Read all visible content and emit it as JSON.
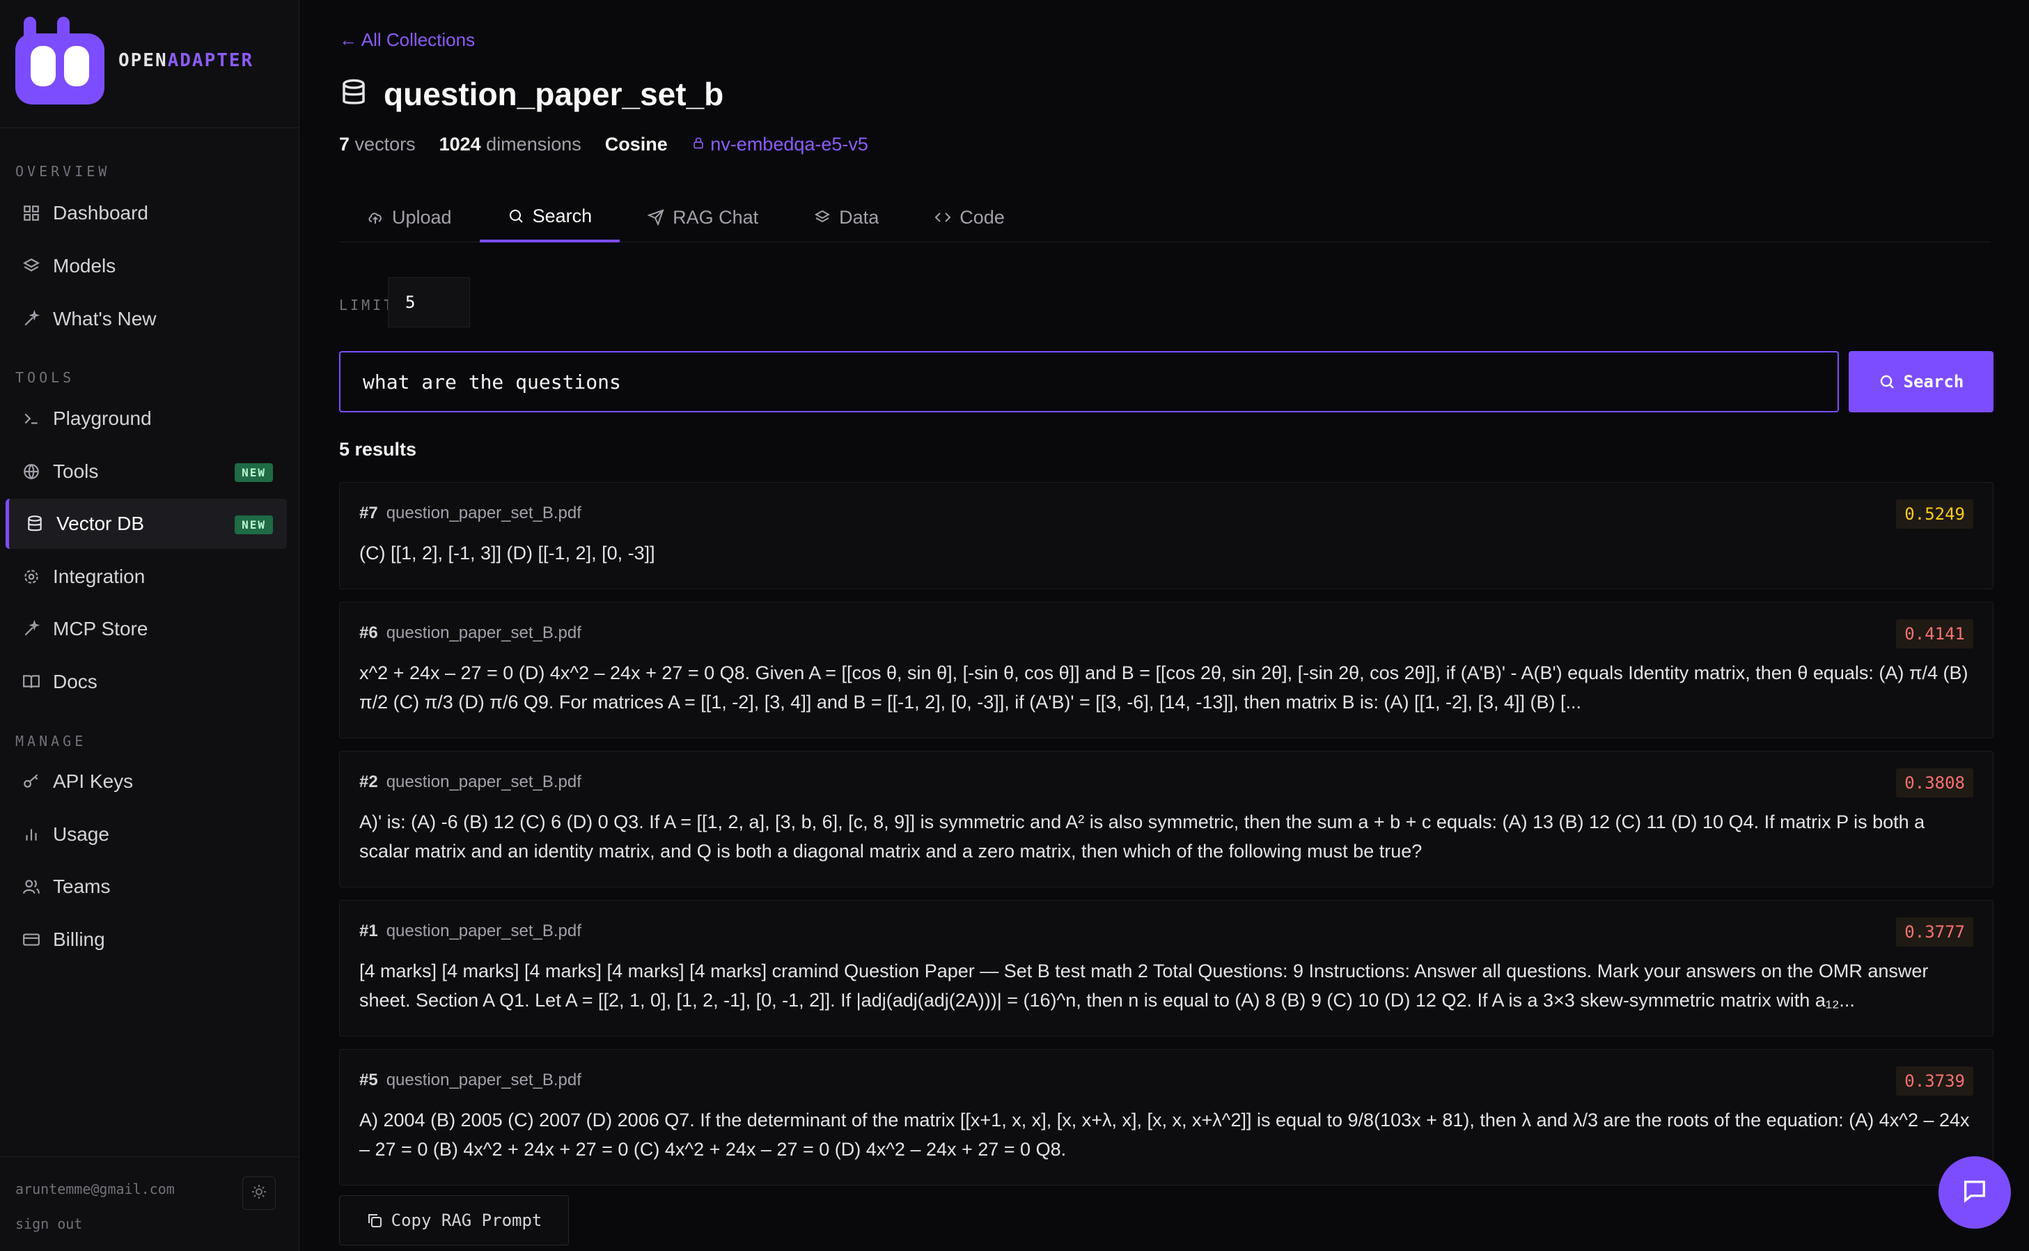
{
  "brand": {
    "part1": "OPEN",
    "part2": "ADAPTER"
  },
  "sidebar": {
    "sections": [
      {
        "label": "OVERVIEW",
        "items": [
          {
            "label": "Dashboard",
            "icon": "grid-icon"
          },
          {
            "label": "Models",
            "icon": "layers-icon"
          },
          {
            "label": "What's New",
            "icon": "sparkle-icon"
          }
        ]
      },
      {
        "label": "TOOLS",
        "items": [
          {
            "label": "Playground",
            "icon": "terminal-icon"
          },
          {
            "label": "Tools",
            "icon": "globe-icon",
            "badge": "NEW"
          },
          {
            "label": "Vector DB",
            "icon": "database-icon",
            "badge": "NEW",
            "active": true
          },
          {
            "label": "Integration",
            "icon": "gear-icon"
          },
          {
            "label": "MCP Store",
            "icon": "sparkle-icon"
          },
          {
            "label": "Docs",
            "icon": "book-icon"
          }
        ]
      },
      {
        "label": "MANAGE",
        "items": [
          {
            "label": "API Keys",
            "icon": "key-icon"
          },
          {
            "label": "Usage",
            "icon": "bar-chart-icon"
          },
          {
            "label": "Teams",
            "icon": "users-icon"
          },
          {
            "label": "Billing",
            "icon": "credit-card-icon"
          }
        ]
      }
    ],
    "user_email": "aruntemme@gmail.com",
    "sign_out": "sign out"
  },
  "header": {
    "back_link": "← All Collections",
    "title": "question_paper_set_b",
    "vectors_count": "7",
    "vectors_label": "vectors",
    "dimensions_count": "1024",
    "dimensions_label": "dimensions",
    "metric": "Cosine",
    "model": "nv-embedqa-e5-v5"
  },
  "tabs": [
    {
      "label": "Upload",
      "icon": "upload-icon"
    },
    {
      "label": "Search",
      "icon": "search-icon",
      "active": true
    },
    {
      "label": "RAG Chat",
      "icon": "send-icon"
    },
    {
      "label": "Data",
      "icon": "layers-icon"
    },
    {
      "label": "Code",
      "icon": "code-icon"
    }
  ],
  "search": {
    "limit_label": "LIMIT",
    "limit_value": "5",
    "query": "what are the questions",
    "button_label": "Search",
    "results_count": "5 results"
  },
  "results": [
    {
      "num": "#7",
      "source": "question_paper_set_B.pdf",
      "score": "0.5249",
      "score_color": "#facc15",
      "text": "(C) [[1, 2], [-1, 3]] (D) [[-1, 2], [0, -3]]"
    },
    {
      "num": "#6",
      "source": "question_paper_set_B.pdf",
      "score": "0.4141",
      "score_color": "#f87171",
      "text": "x^2 + 24x – 27 = 0 (D) 4x^2 – 24x + 27 = 0 Q8. Given A = [[cos θ, sin θ], [-sin θ, cos θ]] and B = [[cos 2θ, sin 2θ], [-sin 2θ, cos 2θ]], if (A'B)' - A(B') equals Identity matrix, then θ equals: (A) π/4 (B) π/2 (C) π/3 (D) π/6 Q9. For matrices A = [[1, -2], [3, 4]] and B = [[-1, 2], [0, -3]], if (A'B)' = [[3, -6], [14, -13]], then matrix B is: (A) [[1, -2], [3, 4]] (B) [..."
    },
    {
      "num": "#2",
      "source": "question_paper_set_B.pdf",
      "score": "0.3808",
      "score_color": "#f87171",
      "text": "A)' is: (A) -6 (B) 12 (C) 6 (D) 0 Q3. If A = [[1, 2, a], [3, b, 6], [c, 8, 9]] is symmetric and A² is also symmetric, then the sum a + b + c equals: (A) 13 (B) 12 (C) 11 (D) 10 Q4. If matrix P is both a scalar matrix and an identity matrix, and Q is both a diagonal matrix and a zero matrix, then which of the following must be true?"
    },
    {
      "num": "#1",
      "source": "question_paper_set_B.pdf",
      "score": "0.3777",
      "score_color": "#f87171",
      "text": "[4 marks] [4 marks] [4 marks] [4 marks] [4 marks] cramind Question Paper — Set B test math 2 Total Questions: 9 Instructions: Answer all questions. Mark your answers on the OMR answer sheet. Section A Q1. Let A = [[2, 1, 0], [1, 2, -1], [0, -1, 2]]. If |adj(adj(adj(2A)))| = (16)^n, then n is equal to (A) 8 (B) 9 (C) 10 (D) 12 Q2. If A is a 3×3 skew-symmetric matrix with a₁₂..."
    },
    {
      "num": "#5",
      "source": "question_paper_set_B.pdf",
      "score": "0.3739",
      "score_color": "#f87171",
      "text": "A) 2004 (B) 2005 (C) 2007 (D) 2006 Q7. If the determinant of the matrix [[x+1, x, x], [x, x+λ, x], [x, x, x+λ^2]] is equal to 9/8(103x + 81), then λ and λ/3 are the roots of the equation: (A) 4x^2 – 24x – 27 = 0 (B) 4x^2 + 24x + 27 = 0 (C) 4x^2 + 24x – 27 = 0 (D) 4x^2 – 24x + 27 = 0 Q8."
    }
  ],
  "copy_button": "Copy RAG Prompt",
  "colors": {
    "accent": "#7c4dff",
    "badge_new": "#1e6b45"
  }
}
